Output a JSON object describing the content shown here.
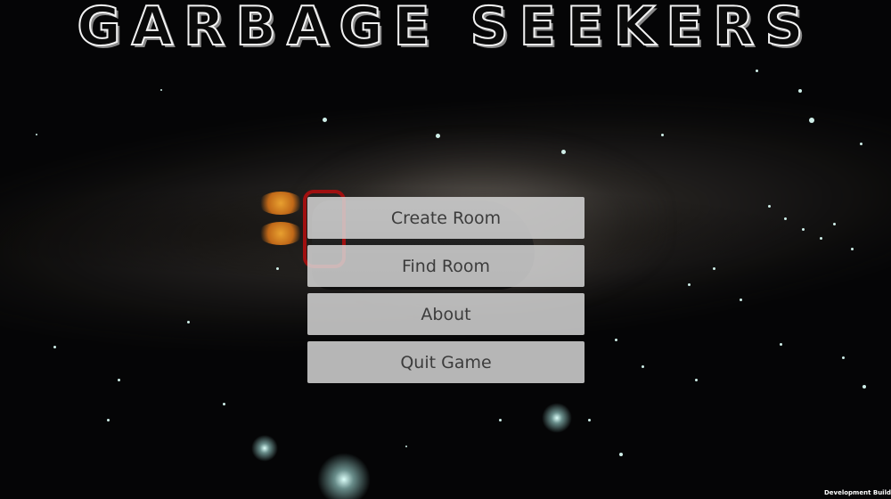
{
  "game": {
    "title": "GARBAGE SEEKERS"
  },
  "menu": {
    "items": [
      {
        "label": "Create Room"
      },
      {
        "label": "Find Room"
      },
      {
        "label": "About"
      },
      {
        "label": "Quit Game"
      }
    ]
  },
  "footer": {
    "build_label": "Development Build"
  },
  "colors": {
    "button_bg": "#d6d6d6",
    "button_text": "#3c3c3c",
    "title_outline": "#f2f2f2",
    "background": "#050506"
  }
}
